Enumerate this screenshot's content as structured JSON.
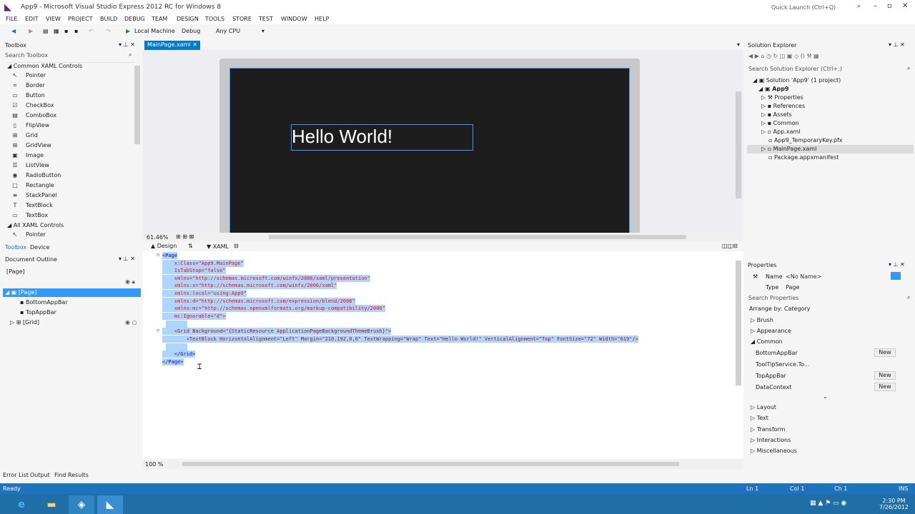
{
  "window": {
    "title": "App9 - Microsoft Visual Studio Express 2012 RC for Windows 8",
    "quick_launch": "Quick Launch (Ctrl+Q)"
  },
  "menu": [
    "FILE",
    "EDIT",
    "VIEW",
    "PROJECT",
    "BUILD",
    "DEBUG",
    "TEAM",
    "DESIGN",
    "TOOLS",
    "STORE",
    "TEST",
    "WINDOW",
    "HELP"
  ],
  "toolbar": {
    "run_target": "Local Machine",
    "config": "Debug",
    "platform": "Any CPU"
  },
  "toolbox": {
    "title": "Toolbox",
    "search": "Search Toolbox",
    "group1": "Common XAML Controls",
    "items": [
      "Pointer",
      "Border",
      "Button",
      "CheckBox",
      "ComboBox",
      "FlipView",
      "Grid",
      "GridView",
      "Image",
      "ListView",
      "RadioButton",
      "Rectangle",
      "StackPanel",
      "TextBlock",
      "TextBox"
    ],
    "group2": "All XAML Controls",
    "item2": "Pointer",
    "tab1": "Toolbox",
    "tab2": "Device"
  },
  "outline": {
    "title": "Document Outline",
    "root": "[Page]",
    "sel": "[Page]",
    "items": [
      "BottomAppBar",
      "TopAppBar",
      "[Grid]"
    ]
  },
  "editor": {
    "tab": "MainPage.xaml",
    "zoom": "61.46%",
    "design_tab": "Design",
    "xaml_tab": "XAML",
    "hello": "Hello World!",
    "zoom2": "100 %"
  },
  "xaml": [
    "<Page",
    "    x:Class=\"App9.MainPage\"",
    "    IsTabStop=\"false\"",
    "    xmlns=\"http://schemas.microsoft.com/winfx/2006/xaml/presentation\"",
    "    xmlns:x=\"http://schemas.microsoft.com/winfx/2006/xaml\"",
    "    xmlns:local=\"using:App9\"",
    "    xmlns:d=\"http://schemas.microsoft.com/expression/blend/2008\"",
    "    xmlns:mc=\"http://schemas.openxmlformats.org/markup-compatibility/2006\"",
    "    mc:Ignorable=\"d\">",
    "",
    "    <Grid Background=\"{StaticResource ApplicationPageBackgroundThemeBrush}\">",
    "        <TextBlock HorizontalAlignment=\"Left\" Margin=\"210,192,0,0\" TextWrapping=\"Wrap\" Text=\"Hello World!\" VerticalAlignment=\"Top\" FontSize=\"72\" Width=\"619\"/>",
    "",
    "    </Grid>",
    "</Page>"
  ],
  "solution": {
    "title": "Solution Explorer",
    "search": "Search Solution Explorer (Ctrl+;)",
    "solution": "Solution 'App9' (1 project)",
    "project": "App9",
    "items": [
      "Properties",
      "References",
      "Assets",
      "Common",
      "App.xaml",
      "App9_TemporaryKey.pfx",
      "MainPage.xaml",
      "Package.appxmanifest"
    ]
  },
  "properties": {
    "title": "Properties",
    "name_label": "Name",
    "name_value": "<No Name>",
    "type_label": "Type",
    "type_value": "Page",
    "search": "Search Properties",
    "arrange": "Arrange by: Category",
    "cats": [
      "Brush",
      "Appearance",
      "Common"
    ],
    "common_items": [
      "BottomAppBar",
      "ToolTipService.To...",
      "TopAppBar",
      "DataContext"
    ],
    "new_label": "New",
    "more_cats": [
      "Layout",
      "Text",
      "Transform",
      "Interactions",
      "Miscellaneous"
    ]
  },
  "bottom_tabs": [
    "Error List",
    "Output",
    "Find Results"
  ],
  "status": {
    "ready": "Ready",
    "ln": "Ln 1",
    "col": "Col 1",
    "ch": "Ch 1",
    "ins": "INS"
  },
  "clock": {
    "time": "2:30 PM",
    "date": "7/26/2012"
  }
}
